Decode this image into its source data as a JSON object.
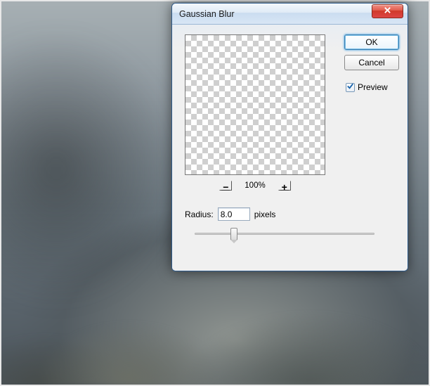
{
  "dialog": {
    "title": "Gaussian Blur",
    "buttons": {
      "ok": "OK",
      "cancel": "Cancel"
    },
    "preview": {
      "label": "Preview",
      "checked": true
    },
    "zoom": {
      "level": "100%"
    },
    "radius": {
      "label": "Radius:",
      "value": "8.0",
      "unit": "pixels",
      "slider_percent": 22
    }
  }
}
